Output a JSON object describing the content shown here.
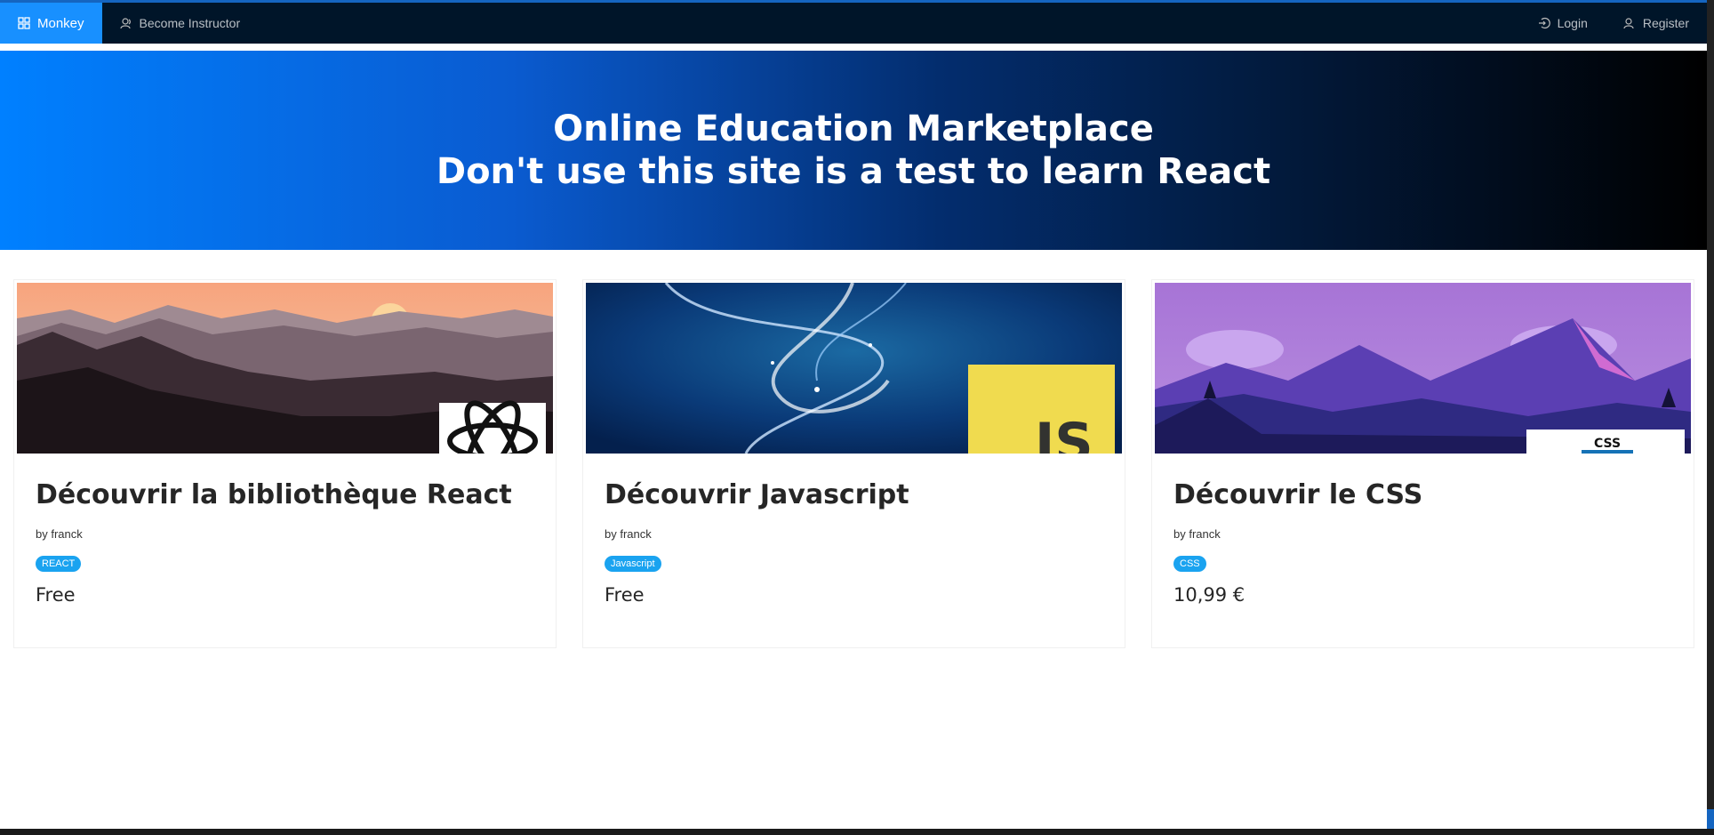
{
  "nav": {
    "brand_label": "Monkey",
    "become_instructor_label": "Become Instructor",
    "login_label": "Login",
    "register_label": "Register",
    "brand_icon": "appstore-icon",
    "instructor_icon": "team-icon",
    "login_icon": "login-icon",
    "register_icon": "user-add-icon",
    "active_color": "#1890ff",
    "bg_color": "#001529"
  },
  "hero": {
    "line1": "Online Education Marketplace",
    "line2": "Don't use this site is a test to learn React"
  },
  "courses": [
    {
      "title": "Découvrir la bibliothèque React",
      "author": "by franck",
      "tag": "REACT",
      "price": "Free"
    },
    {
      "title": "Découvrir Javascript",
      "author": "by franck",
      "tag": "Javascript",
      "price": "Free"
    },
    {
      "title": "Découvrir le CSS",
      "author": "by franck",
      "tag": "CSS",
      "price": "10,99 €"
    }
  ],
  "colors": {
    "tag_bg": "#1aa3f0",
    "hero_start": "#0080ff",
    "hero_end": "#000000"
  },
  "course_images": {
    "react_logo_text": "",
    "js_logo_text": "JS",
    "css_logo_text": "CSS"
  }
}
